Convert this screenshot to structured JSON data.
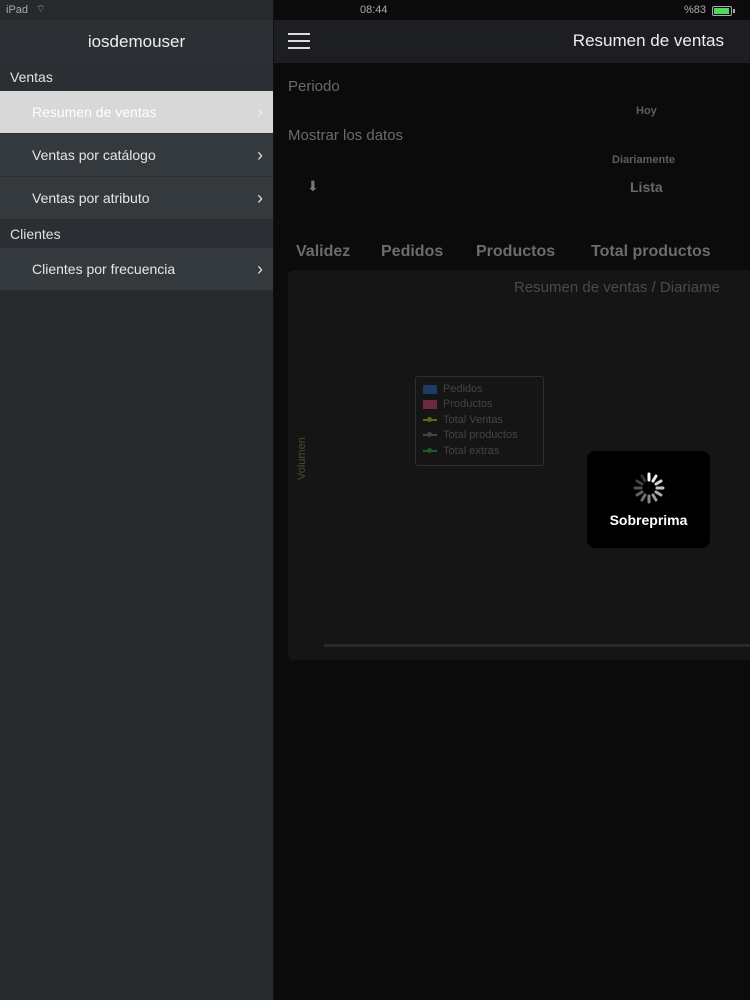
{
  "status": {
    "carrier": "iPad",
    "time": "08:44",
    "battery": "%83"
  },
  "sidebar": {
    "user": "iosdemouser",
    "sections": [
      {
        "title": "Ventas",
        "items": [
          "Resumen de ventas",
          "Ventas por catálogo",
          "Ventas por atributo"
        ]
      },
      {
        "title": "Clientes",
        "items": [
          "Clientes por frecuencia"
        ]
      }
    ]
  },
  "nav": {
    "title": "Resumen de ventas"
  },
  "filters": {
    "period_label": "Periodo",
    "period_value": "Hoy",
    "show_label": "Mostrar los datos",
    "show_value": "Diariamente",
    "view_value": "Lista"
  },
  "tabs": [
    "Validez",
    "Pedidos",
    "Productos",
    "Total productos"
  ],
  "chart": {
    "title": "Resumen de ventas / Diariame",
    "ylabel": "Volumen",
    "legend": [
      {
        "name": "Pedidos",
        "color": "#1f3a66",
        "kind": "bar"
      },
      {
        "name": "Productos",
        "color": "#6b2a3e",
        "kind": "bar"
      },
      {
        "name": "Total Ventas",
        "color": "#5c6a18",
        "kind": "line"
      },
      {
        "name": "Total productos",
        "color": "#444444",
        "kind": "line"
      },
      {
        "name": "Total extras",
        "color": "#1f5a22",
        "kind": "line"
      }
    ]
  },
  "hud": {
    "text": "Sobreprima"
  }
}
